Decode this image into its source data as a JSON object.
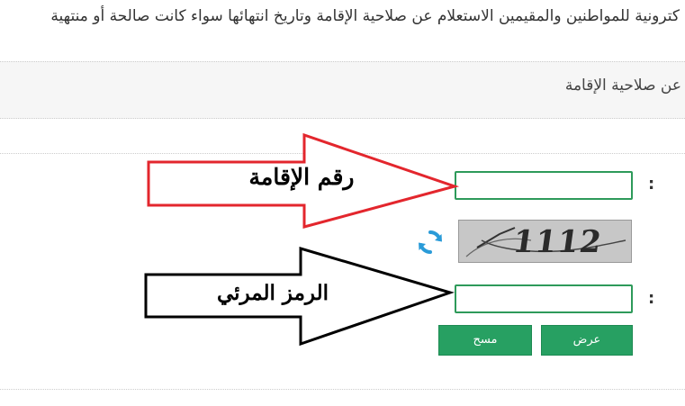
{
  "intro_text": "كترونية للمواطنين والمقيمين الاستعلام عن صلاحية الإقامة وتاريخ انتهائها سواء كانت صالحة أو منتهية",
  "section": {
    "title": "عن صلاحية الإقامة"
  },
  "form": {
    "residence_colon": ":",
    "residence_value": "",
    "captcha_text": "1112",
    "captcha_colon": ":",
    "captcha_value": "",
    "show_button": "عرض",
    "clear_button": "مسح"
  },
  "annotations": {
    "residence_label": "رقم الإقامة",
    "captcha_label": "الرمز المرئي",
    "residence_arrow_color": "#e3262d",
    "captcha_arrow_color": "#000000"
  },
  "colors": {
    "accent_green": "#27a062",
    "input_border": "#2e9a5a",
    "refresh_blue": "#2a9bd8"
  },
  "icons": {
    "refresh": "refresh-icon"
  }
}
